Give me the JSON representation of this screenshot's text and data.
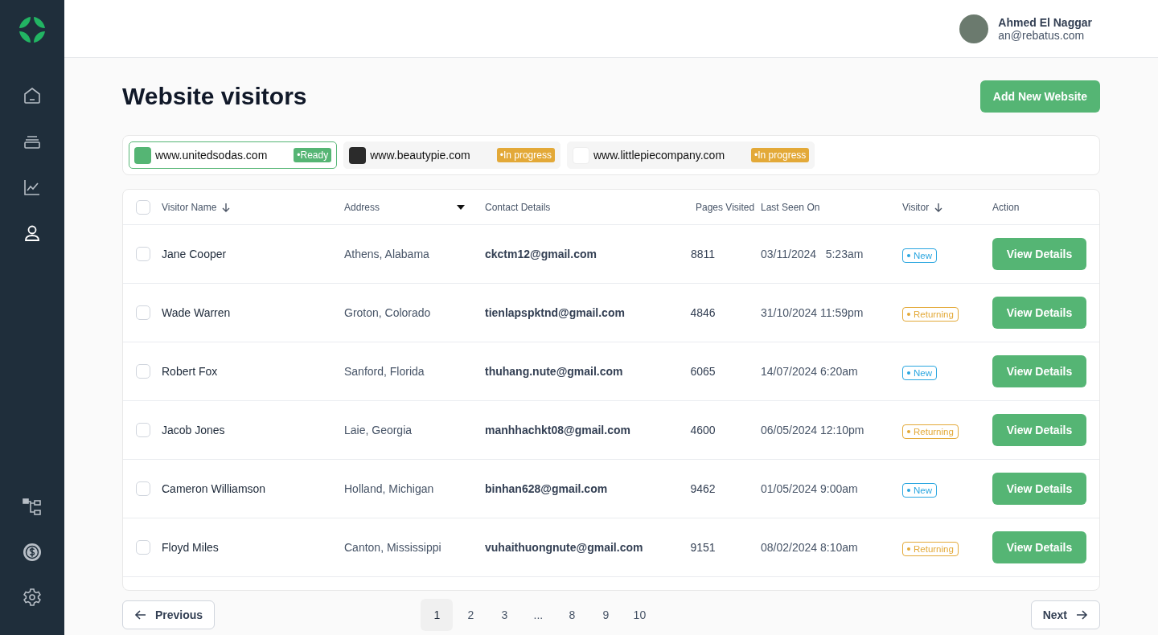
{
  "user": {
    "name": "Ahmed El Naggar",
    "email": "an@rebatus.com"
  },
  "page": {
    "title": "Website visitors",
    "add_button": "Add New Website"
  },
  "sites": [
    {
      "url": "www.unitedsodas.com",
      "status": "•Ready",
      "kind": "ready",
      "selected": true
    },
    {
      "url": "www.beautypie.com",
      "status": "•In progress",
      "kind": "progress",
      "selected": false
    },
    {
      "url": "www.littlepiecompany.com",
      "status": "•In progress",
      "kind": "progress",
      "selected": false
    }
  ],
  "table": {
    "all_checked": false,
    "columns": [
      "Visitor Name",
      "Address",
      "Contact Details",
      "Pages Visited",
      "Last Seen On",
      "Visitor",
      "Action"
    ],
    "rows": [
      {
        "checked": false,
        "name": "Jane Cooper",
        "address": "Athens, Alabama",
        "email": "ckctm12@gmail.com",
        "pages": "8811",
        "last_seen": "03/11/2024   5:23am",
        "visitor": "New",
        "kind": "new",
        "action": "View Details"
      },
      {
        "checked": false,
        "name": "Wade Warren",
        "address": "Groton, Colorado",
        "email": "tienlapspktnd@gmail.com",
        "pages": "4846",
        "last_seen": "31/10/2024 11:59pm",
        "visitor": "Returning",
        "kind": "returning",
        "action": "View Details"
      },
      {
        "checked": false,
        "name": "Robert Fox",
        "address": "Sanford, Florida",
        "email": "thuhang.nute@gmail.com",
        "pages": "6065",
        "last_seen": "14/07/2024 6:20am",
        "visitor": "New",
        "kind": "new",
        "action": "View Details"
      },
      {
        "checked": false,
        "name": "Jacob Jones",
        "address": "Laie, Georgia",
        "email": "manhhachkt08@gmail.com",
        "pages": "4600",
        "last_seen": "06/05/2024 12:10pm",
        "visitor": "Returning",
        "kind": "returning",
        "action": "View Details"
      },
      {
        "checked": false,
        "name": "Cameron Williamson",
        "address": "Holland, Michigan",
        "email": "binhan628@gmail.com",
        "pages": "9462",
        "last_seen": "01/05/2024 9:00am",
        "visitor": "New",
        "kind": "new",
        "action": "View Details"
      },
      {
        "checked": false,
        "name": "Floyd Miles",
        "address": "Canton, Mississippi",
        "email": "vuhaithuongnute@gmail.com",
        "pages": "9151",
        "last_seen": "08/02/2024 8:10am",
        "visitor": "Returning",
        "kind": "returning",
        "action": "View Details"
      }
    ]
  },
  "pagination": {
    "previous": "Previous",
    "next": "Next",
    "pages": [
      {
        "label": "1",
        "selected": true
      },
      {
        "label": "2",
        "selected": false
      },
      {
        "label": "3",
        "selected": false
      },
      {
        "label": "...",
        "selected": false
      },
      {
        "label": "8",
        "selected": false
      },
      {
        "label": "9",
        "selected": false
      },
      {
        "label": "10",
        "selected": false
      }
    ]
  }
}
